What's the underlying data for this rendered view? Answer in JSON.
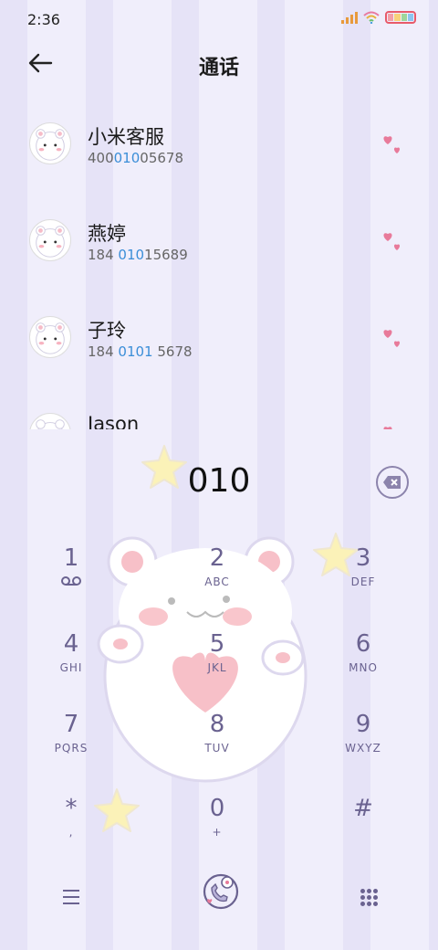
{
  "status": {
    "time": "2:36"
  },
  "header": {
    "title": "通话"
  },
  "contacts": [
    {
      "name": "小米客服",
      "num_pre": "400",
      "num_hl": "010",
      "num_post": "05678"
    },
    {
      "name": "燕婷",
      "num_pre": "184 ",
      "num_hl": "010",
      "num_post": "15689"
    },
    {
      "name": "子玲",
      "num_pre": "184 ",
      "num_hl": "0101",
      "num_post": " 5678"
    },
    {
      "name": "Jason",
      "num_pre": "",
      "num_hl": "",
      "num_post": ""
    }
  ],
  "dialer": {
    "input": "010",
    "keys": [
      {
        "digit": "1",
        "letters": ""
      },
      {
        "digit": "2",
        "letters": "ABC"
      },
      {
        "digit": "3",
        "letters": "DEF"
      },
      {
        "digit": "4",
        "letters": "GHI"
      },
      {
        "digit": "5",
        "letters": "JKL"
      },
      {
        "digit": "6",
        "letters": "MNO"
      },
      {
        "digit": "7",
        "letters": "PQRS"
      },
      {
        "digit": "8",
        "letters": "TUV"
      },
      {
        "digit": "9",
        "letters": "WXYZ"
      },
      {
        "digit": "*",
        "letters": ","
      },
      {
        "digit": "0",
        "letters": "+"
      },
      {
        "digit": "#",
        "letters": ""
      }
    ]
  },
  "colors": {
    "accent": "#3b8ed8",
    "key_text": "#6a6290",
    "heart": "#e87a9a",
    "star": "#fbf2b8"
  },
  "icons": [
    "back-arrow-icon",
    "voicemail-icon",
    "backspace-icon",
    "menu-icon",
    "phone-call-icon",
    "dialpad-icon",
    "heart-icon",
    "star-icon"
  ]
}
